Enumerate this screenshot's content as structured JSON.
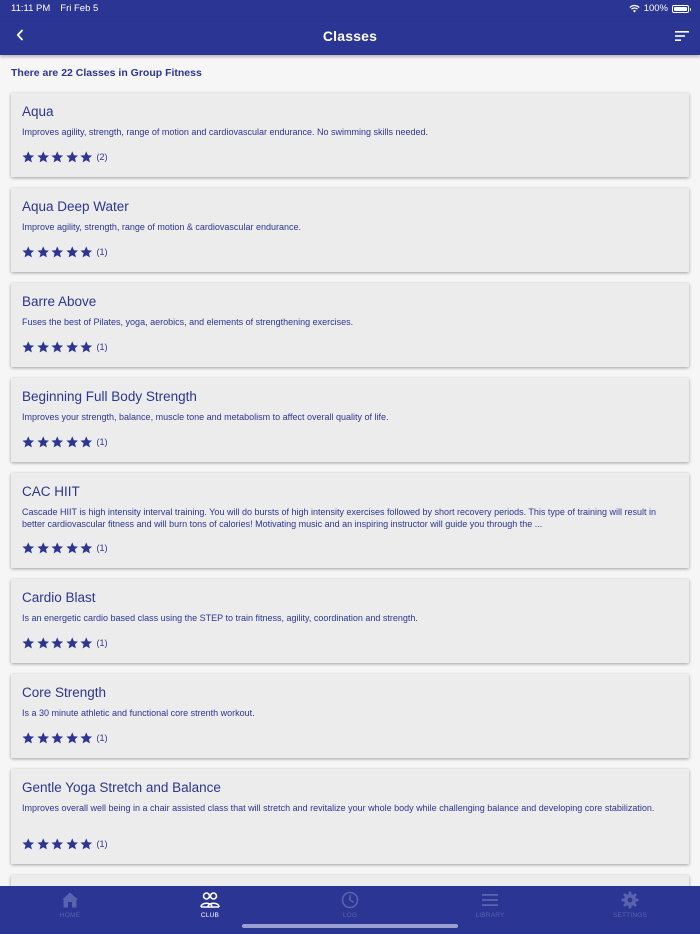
{
  "status_bar": {
    "time": "11:11 PM",
    "date": "Fri Feb 5",
    "battery": "100%"
  },
  "header": {
    "title": "Classes"
  },
  "summary": "There are 22 Classes in Group Fitness",
  "classes": [
    {
      "name": "Aqua",
      "description": "Improves agility, strength, range of motion and cardiovascular endurance. No swimming skills needed.",
      "rating": 5,
      "count": "(2)"
    },
    {
      "name": "Aqua Deep Water",
      "description": "Improve agility, strength, range of motion & cardiovascular endurance.",
      "rating": 5,
      "count": "(1)"
    },
    {
      "name": "Barre Above",
      "description": "Fuses the best of Pilates, yoga, aerobics, and elements of strengthening exercises.",
      "rating": 5,
      "count": "(1)"
    },
    {
      "name": "Beginning Full Body Strength",
      "description": "Improves your strength, balance, muscle tone and metabolism to affect overall quality of life.",
      "rating": 5,
      "count": "(1)"
    },
    {
      "name": "CAC HIIT",
      "description": "Cascade HIIT is high intensity interval training. You will do bursts of high intensity exercises followed by short recovery periods. This type of training will result in better cardiovascular fitness and will burn tons of calories! Motivating music and an inspiring instructor will guide you through the ...",
      "rating": 5,
      "count": "(1)"
    },
    {
      "name": "Cardio Blast",
      "description": "Is an energetic cardio based class using the STEP to train fitness, agility, coordination and strength.",
      "rating": 5,
      "count": "(1)"
    },
    {
      "name": "Core Strength",
      "description": "Is a 30 minute athletic and functional core strenth workout.",
      "rating": 5,
      "count": "(1)"
    },
    {
      "name": "Gentle Yoga Stretch and Balance",
      "description": "Improves overall well being in a chair assisted class that will stretch and revitalize your whole body while challenging balance and developing core stabilization.",
      "rating": 5,
      "count": "(1)"
    }
  ],
  "tab_bar": {
    "tabs": [
      {
        "label": "HOME",
        "icon": "home-icon",
        "active": false
      },
      {
        "label": "CLUB",
        "icon": "people-icon",
        "active": true
      },
      {
        "label": "LOG",
        "icon": "clock-icon",
        "active": false
      },
      {
        "label": "LIBRARY",
        "icon": "list-icon",
        "active": false
      },
      {
        "label": "SETTINGS",
        "icon": "gear-icon",
        "active": false
      }
    ]
  },
  "colors": {
    "primary": "#2b3593",
    "card_bg": "#ececec",
    "page_bg": "#f6f6f6",
    "inactive_tab": "#5a63ad"
  }
}
